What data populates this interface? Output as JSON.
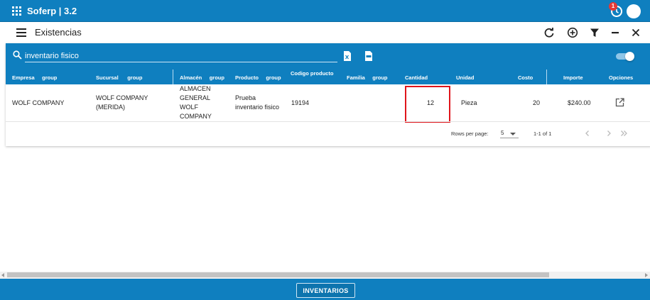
{
  "app": {
    "title": "Soferp | 3.2",
    "notification_count": "1"
  },
  "page": {
    "title": "Existencias"
  },
  "toolbar_icons": [
    "refresh-icon",
    "add-circle-icon",
    "filter-icon",
    "minus-icon",
    "close-icon"
  ],
  "search": {
    "value": "inventario fisico",
    "placeholder": ""
  },
  "export_icons": [
    "excel-file-icon",
    "pdf-file-icon"
  ],
  "toggle": {
    "on": true
  },
  "table": {
    "columns": [
      {
        "label": "Empresa",
        "group": "group"
      },
      {
        "label": "Sucursal",
        "group": "group"
      },
      {
        "label": "Almacén",
        "group": "group"
      },
      {
        "label": "Producto",
        "group": "group"
      },
      {
        "label": "Codigo producto",
        "group": ""
      },
      {
        "label": "Familia",
        "group": "group"
      },
      {
        "label": "Cantidad",
        "group": ""
      },
      {
        "label": "Unidad",
        "group": ""
      },
      {
        "label": "Costo",
        "group": ""
      },
      {
        "label": "Importe",
        "group": ""
      },
      {
        "label": "Opciones",
        "group": ""
      }
    ],
    "rows": [
      {
        "empresa": "WOLF COMPANY",
        "sucursal": [
          "WOLF COMPANY",
          "(MERIDA)"
        ],
        "almacen": [
          "ALMACEN",
          "GENERAL",
          "WOLF",
          "COMPANY"
        ],
        "producto": [
          "Prueba",
          "inventario fisico"
        ],
        "codigo": "19194",
        "familia": "",
        "cantidad": "12",
        "unidad": "Pieza",
        "costo": "20",
        "importe": "$240.00"
      }
    ]
  },
  "pagination": {
    "rows_per_page_label": "Rows per page:",
    "rows_per_page": "5",
    "range": "1-1 of 1"
  },
  "bottom": {
    "button_label": "INVENTARIOS"
  },
  "colors": {
    "primary": "#0f7fbf",
    "highlight": "#e0151b"
  }
}
